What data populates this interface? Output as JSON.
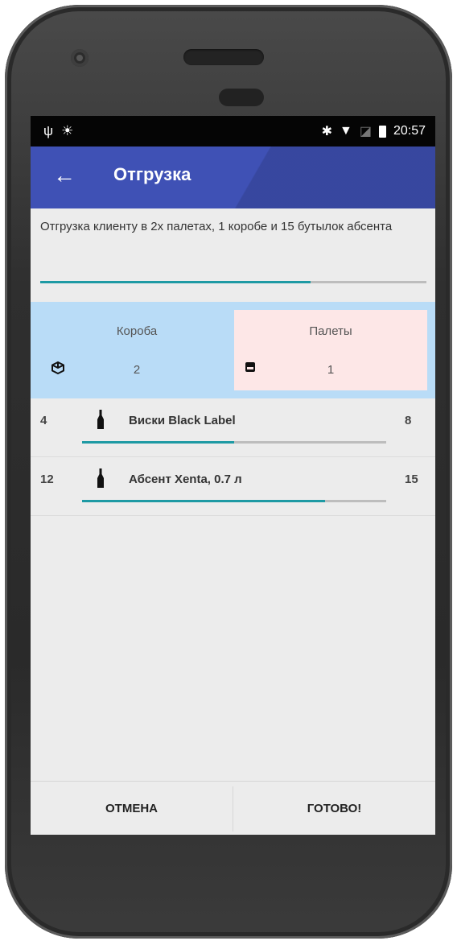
{
  "status_bar": {
    "left_icons": [
      "usb-icon",
      "android-debug-icon"
    ],
    "right_icons": [
      "bluetooth-icon",
      "wifi-icon",
      "no-signal-icon",
      "battery-icon"
    ],
    "time": "20:57"
  },
  "app_bar": {
    "back_glyph": "←",
    "title": "Отгрузка",
    "color": "#3f51b5"
  },
  "description": "Отгрузка клиенту в 2х палетах, 1 коробе и 15 бутылок абсента",
  "overall_progress": 0.7,
  "summary": {
    "boxes": {
      "label": "Короба",
      "count": "2",
      "icon": "box-icon",
      "bg": "#b9dcf7"
    },
    "pallets": {
      "label": "Палеты",
      "count": "1",
      "icon": "pallet-icon",
      "bg": "#fde7e7"
    }
  },
  "items": [
    {
      "qty": "4",
      "name": "Виски Black Label",
      "total": "8",
      "progress": 0.5,
      "icon": "bottle-icon"
    },
    {
      "qty": "12",
      "name": "Абсент Xenta, 0.7 л",
      "total": "15",
      "progress": 0.8,
      "icon": "bottle-icon"
    }
  ],
  "actions": {
    "cancel": "ОТМЕНА",
    "done": "ГОТОВО!"
  },
  "accent": "#1e9aa4"
}
